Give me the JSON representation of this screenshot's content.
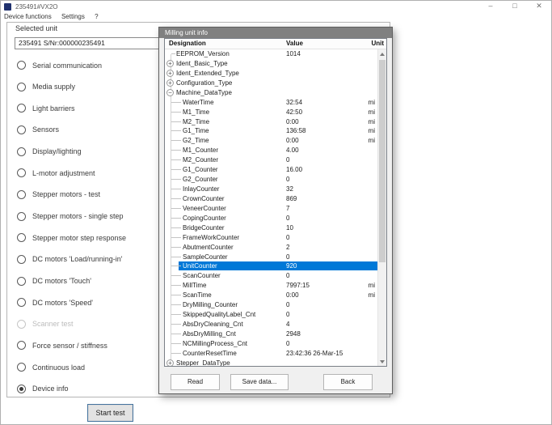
{
  "window": {
    "title": "235491#VX2O",
    "menu": [
      "Device functions",
      "Settings",
      "?"
    ],
    "controls": {
      "minimize": "–",
      "maximize": "□",
      "close": "✕"
    }
  },
  "panel": {
    "selected_unit_label": "Selected unit",
    "selected_unit_value": "235491 S/Nr:000000235491",
    "options": [
      {
        "label": "Serial communication",
        "state": "normal"
      },
      {
        "label": "Media supply",
        "state": "normal"
      },
      {
        "label": "Light barriers",
        "state": "normal"
      },
      {
        "label": "Sensors",
        "state": "normal"
      },
      {
        "label": "Display/lighting",
        "state": "normal"
      },
      {
        "label": "L-motor adjustment",
        "state": "normal"
      },
      {
        "label": "Stepper motors - test",
        "state": "normal"
      },
      {
        "label": "Stepper motors - single step",
        "state": "normal"
      },
      {
        "label": "Stepper motor step response",
        "state": "normal"
      },
      {
        "label": "DC motors 'Load/running-in'",
        "state": "normal"
      },
      {
        "label": "DC motors 'Touch'",
        "state": "normal"
      },
      {
        "label": "DC motors 'Speed'",
        "state": "normal"
      },
      {
        "label": "Scanner test",
        "state": "disabled"
      },
      {
        "label": "Force sensor / stiffness",
        "state": "normal"
      },
      {
        "label": "Continuous load",
        "state": "normal"
      },
      {
        "label": "Device info",
        "state": "selected"
      }
    ],
    "start_button": "Start test"
  },
  "dialog": {
    "title": "Milling unit info",
    "columns": [
      "Designation",
      "Value",
      "Unit"
    ],
    "rows": [
      {
        "label": "EEPROM_Version",
        "value": "1014",
        "unit": "",
        "level": 0,
        "exp": "leaf"
      },
      {
        "label": "Ident_Basic_Type",
        "value": "",
        "unit": "",
        "level": 0,
        "exp": "plus"
      },
      {
        "label": "Ident_Extended_Type",
        "value": "",
        "unit": "",
        "level": 0,
        "exp": "plus"
      },
      {
        "label": "Configuration_Type",
        "value": "",
        "unit": "",
        "level": 0,
        "exp": "plus"
      },
      {
        "label": "Machine_DataType",
        "value": "",
        "unit": "",
        "level": 0,
        "exp": "minus"
      },
      {
        "label": "WaterTime",
        "value": "32:54",
        "unit": "mi",
        "level": 1
      },
      {
        "label": "M1_Time",
        "value": "42:50",
        "unit": "mi",
        "level": 1
      },
      {
        "label": "M2_Time",
        "value": "0:00",
        "unit": "mi",
        "level": 1
      },
      {
        "label": "G1_Time",
        "value": "136:58",
        "unit": "mi",
        "level": 1
      },
      {
        "label": "G2_Time",
        "value": "0:00",
        "unit": "mi",
        "level": 1
      },
      {
        "label": "M1_Counter",
        "value": "4.00",
        "unit": "",
        "level": 1
      },
      {
        "label": "M2_Counter",
        "value": "0",
        "unit": "",
        "level": 1
      },
      {
        "label": "G1_Counter",
        "value": "16.00",
        "unit": "",
        "level": 1
      },
      {
        "label": "G2_Counter",
        "value": "0",
        "unit": "",
        "level": 1
      },
      {
        "label": "InlayCounter",
        "value": "32",
        "unit": "",
        "level": 1
      },
      {
        "label": "CrownCounter",
        "value": "869",
        "unit": "",
        "level": 1
      },
      {
        "label": "VeneerCounter",
        "value": "7",
        "unit": "",
        "level": 1
      },
      {
        "label": "CopingCounter",
        "value": "0",
        "unit": "",
        "level": 1
      },
      {
        "label": "BridgeCounter",
        "value": "10",
        "unit": "",
        "level": 1
      },
      {
        "label": "FrameWorkCounter",
        "value": "0",
        "unit": "",
        "level": 1
      },
      {
        "label": "AbutmentCounter",
        "value": "2",
        "unit": "",
        "level": 1
      },
      {
        "label": "SampleCounter",
        "value": "0",
        "unit": "",
        "level": 1
      },
      {
        "label": "UnitCounter",
        "value": "920",
        "unit": "",
        "level": 1,
        "selected": true
      },
      {
        "label": "ScanCounter",
        "value": "0",
        "unit": "",
        "level": 1
      },
      {
        "label": "MillTime",
        "value": "7997:15",
        "unit": "mi",
        "level": 1
      },
      {
        "label": "ScanTime",
        "value": "0:00",
        "unit": "mi",
        "level": 1
      },
      {
        "label": "DryMilling_Counter",
        "value": "0",
        "unit": "",
        "level": 1
      },
      {
        "label": "SkippedQualityLabel_Cnt",
        "value": "0",
        "unit": "",
        "level": 1
      },
      {
        "label": "AbsDryCleaning_Cnt",
        "value": "4",
        "unit": "",
        "level": 1
      },
      {
        "label": "AbsDryMilling_Cnt",
        "value": "2948",
        "unit": "",
        "level": 1
      },
      {
        "label": "NCMillingProcess_Cnt",
        "value": "0",
        "unit": "",
        "level": 1
      },
      {
        "label": "CounterResetTime",
        "value": "23:42:36 26-Mar-15",
        "unit": "",
        "level": 1
      },
      {
        "label": "Stepper_DataType",
        "value": "",
        "unit": "",
        "level": 0,
        "exp": "plus"
      }
    ],
    "buttons": [
      "Read",
      "Save data...",
      "Back"
    ]
  },
  "colors": {
    "selection": "#0078d7",
    "dialog_title_bg": "#808080"
  }
}
